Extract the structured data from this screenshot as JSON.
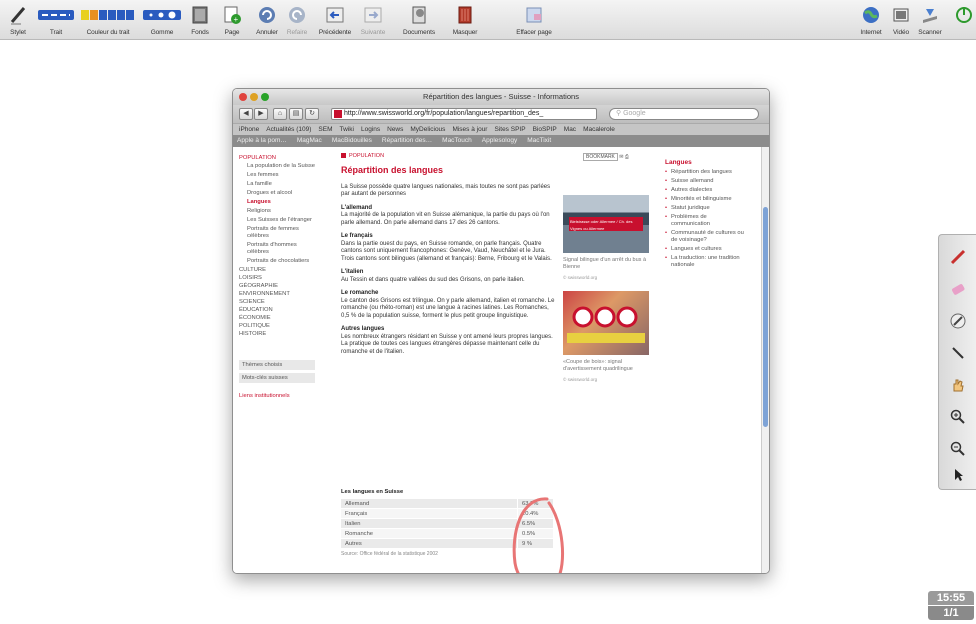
{
  "toolbar": {
    "items": [
      {
        "label": "Stylet",
        "icon": "pen-icon"
      },
      {
        "label": "Trait",
        "icon": "line-style-icon"
      },
      {
        "label": "Couleur du trait",
        "icon": "color-palette-icon"
      },
      {
        "label": "Gomme",
        "icon": "eraser-size-icon"
      },
      {
        "label": "Fonds",
        "icon": "background-icon"
      },
      {
        "label": "Page",
        "icon": "new-page-icon"
      },
      {
        "label": "Annuler",
        "icon": "undo-icon"
      },
      {
        "label": "Refaire",
        "icon": "redo-icon"
      },
      {
        "label": "Précédente",
        "icon": "previous-page-icon"
      },
      {
        "label": "Suivante",
        "icon": "next-page-icon"
      },
      {
        "label": "Documents",
        "icon": "documents-icon"
      },
      {
        "label": "Masquer",
        "icon": "hide-icon"
      },
      {
        "label": "Effacer page",
        "icon": "clear-page-icon"
      },
      {
        "label": "Internet",
        "icon": "globe-icon"
      },
      {
        "label": "Vidéo",
        "icon": "video-icon"
      },
      {
        "label": "Scanner",
        "icon": "scanner-icon"
      }
    ]
  },
  "browser": {
    "window_title": "Répartition des langues - Suisse - Informations",
    "url": "http://www.swissworld.org/fr/population/langues/repartition_des_",
    "search_placeholder": "Google",
    "bookmarks": [
      "iPhone",
      "Actualités (109)",
      "SEM",
      "Twiki",
      "Logins",
      "News",
      "MyDelicious",
      "Mises à jour",
      "Sites SPIP",
      "BioSPIP",
      "Mac",
      "Macalerole"
    ],
    "tabs": [
      "Apple à la pom…",
      "MagMac",
      "MacBidouilles",
      "Répartition des…",
      "MacTouch",
      "Applesology",
      "MacTixit"
    ]
  },
  "leftnav": {
    "section": "POPULATION",
    "subitems": [
      "La population de la Suisse",
      "Les femmes",
      "La famille",
      "Drogues et alcool",
      "Langues",
      "Religions",
      "Les Suisses de l'étranger",
      "Portraits de femmes célèbres",
      "Portraits d'hommes célèbres",
      "Portraits de chocolatiers"
    ],
    "active": "Langues",
    "topics": [
      "CULTURE",
      "LOISIRS",
      "GÉOGRAPHIE",
      "ENVIRONNEMENT",
      "SCIENCE",
      "ÉDUCATION",
      "ÉCONOMIE",
      "POLITIQUE",
      "HISTOIRE"
    ],
    "box_items": [
      "Thèmes choisis",
      "Mots-clés suisses"
    ],
    "institutional_link": "Liens institutionnels"
  },
  "article": {
    "breadcrumb": "POPULATION",
    "bookmark_button": "BOOKMARK",
    "title": "Répartition des langues",
    "intro": "La Suisse possède quatre langues nationales, mais toutes ne sont pas parlées par autant de personnes",
    "sections": [
      {
        "heading": "L'allemand",
        "text": "La majorité de la population vit en Suisse alémanique, la partie du pays où l'on parle allemand. On parle allemand dans 17 des 26 cantons."
      },
      {
        "heading": "Le français",
        "text": "Dans la partie ouest du pays, en Suisse romande, on parle français. Quatre cantons sont uniquement francophones: Genève, Vaud, Neuchâtel et le Jura. Trois cantons sont bilingues (allemand et français): Berne, Fribourg et le Valais."
      },
      {
        "heading": "L'italien",
        "text": "Au Tessin et dans quatre vallées du sud des Grisons, on parle italien."
      },
      {
        "heading": "Le romanche",
        "text": "Le canton des Grisons est trilingue. On y parle allemand, italien et romanche. Le romanche (ou rhéto-roman) est une langue à racines latines. Les Romanches, 0,5 % de la population suisse, forment le plus petit groupe linguistique."
      },
      {
        "heading": "Autres langues",
        "text": "Les nombreux étrangers résidant en Suisse y ont amené leurs propres langues. La pratique de toutes ces langues étrangères dépasse maintenant celle du romanche et de l'italien."
      }
    ]
  },
  "photos": [
    {
      "sign_text": "Bielstrasse oder Allermee / Ch. des Vignes ou Allermee",
      "caption": "Signal bilingue d'un arrêt du bus à Bienne",
      "credit": "© swissworld.org"
    },
    {
      "caption": "«Coupe de bois»: signal d'avertissement quadrilingue",
      "credit": "© swissworld.org"
    }
  ],
  "rightbar": {
    "title": "Langues",
    "items": [
      "Répartition des langues",
      "Suisse allemand",
      "Autres dialectes",
      "Minorités et bilinguisme",
      "Statut juridique",
      "Problèmes de communication",
      "Communauté de cultures ou de voisinage?",
      "Langues et cultures",
      "La traduction: une tradition nationale"
    ]
  },
  "table": {
    "title": "Les langues en Suisse",
    "rows": [
      {
        "language": "Allemand",
        "value": "63.7%"
      },
      {
        "language": "Français",
        "value": "20.4%"
      },
      {
        "language": "Italien",
        "value": "6.5%"
      },
      {
        "language": "Romanche",
        "value": "0.5%"
      },
      {
        "language": "Autres",
        "value": "9 %"
      }
    ],
    "source": "Source: Office fédéral de la statistique 2002"
  },
  "status": {
    "clock": "15:55",
    "page": "1/1"
  },
  "colors": {
    "accent": "#c8102e",
    "annotation": "#e87575"
  }
}
